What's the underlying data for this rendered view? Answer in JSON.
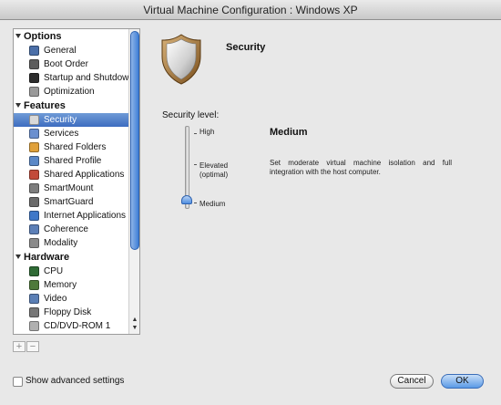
{
  "window": {
    "title": "Virtual Machine Configuration : Windows XP"
  },
  "sidebar": {
    "groups": [
      {
        "label": "Options",
        "items": [
          {
            "label": "General",
            "icon": "monitor-icon",
            "color": "#4b6fa8"
          },
          {
            "label": "Boot Order",
            "icon": "boot-order-icon",
            "color": "#5c5c5c"
          },
          {
            "label": "Startup and Shutdown",
            "icon": "startup-icon",
            "color": "#2d2d2d"
          },
          {
            "label": "Optimization",
            "icon": "optimization-icon",
            "color": "#9a9a9a"
          }
        ]
      },
      {
        "label": "Features",
        "items": [
          {
            "label": "Security",
            "icon": "shield-icon",
            "color": "#d9d9d9",
            "selected": true
          },
          {
            "label": "Services",
            "icon": "services-icon",
            "color": "#6a8fcf"
          },
          {
            "label": "Shared Folders",
            "icon": "folder-icon",
            "color": "#e0a13b"
          },
          {
            "label": "Shared Profile",
            "icon": "profile-icon",
            "color": "#5b88c7"
          },
          {
            "label": "Shared Applications",
            "icon": "applications-icon",
            "color": "#c24a3a"
          },
          {
            "label": "SmartMount",
            "icon": "smartmount-icon",
            "color": "#7d7d7d"
          },
          {
            "label": "SmartGuard",
            "icon": "smartguard-icon",
            "color": "#6a6a6a"
          },
          {
            "label": "Internet Applications",
            "icon": "internet-icon",
            "color": "#3f78c9"
          },
          {
            "label": "Coherence",
            "icon": "coherence-icon",
            "color": "#5c7fb7"
          },
          {
            "label": "Modality",
            "icon": "modality-icon",
            "color": "#8a8a8a"
          }
        ]
      },
      {
        "label": "Hardware",
        "items": [
          {
            "label": "CPU",
            "icon": "cpu-icon",
            "color": "#2f6b35"
          },
          {
            "label": "Memory",
            "icon": "memory-icon",
            "color": "#4f7a3a"
          },
          {
            "label": "Video",
            "icon": "video-icon",
            "color": "#5b7fb5"
          },
          {
            "label": "Floppy Disk",
            "icon": "floppy-icon",
            "color": "#777777"
          },
          {
            "label": "CD/DVD-ROM 1",
            "icon": "cd-icon",
            "color": "#b0b0b0"
          }
        ]
      }
    ],
    "add_label": "+",
    "remove_label": "−"
  },
  "content": {
    "title": "Security",
    "level_label": "Security level:",
    "levels": [
      {
        "label": "High"
      },
      {
        "label": "Elevated\n(optimal)"
      },
      {
        "label": "Medium"
      }
    ],
    "selected_level": "Medium",
    "description_title": "Medium",
    "description": "Set moderate virtual machine isolation and full integration with the host computer."
  },
  "footer": {
    "advanced_label": "Show advanced settings",
    "advanced_checked": false,
    "cancel_label": "Cancel",
    "ok_label": "OK"
  },
  "colors": {
    "accent": "#3d6cc0",
    "selection": "#5b8bd3"
  }
}
